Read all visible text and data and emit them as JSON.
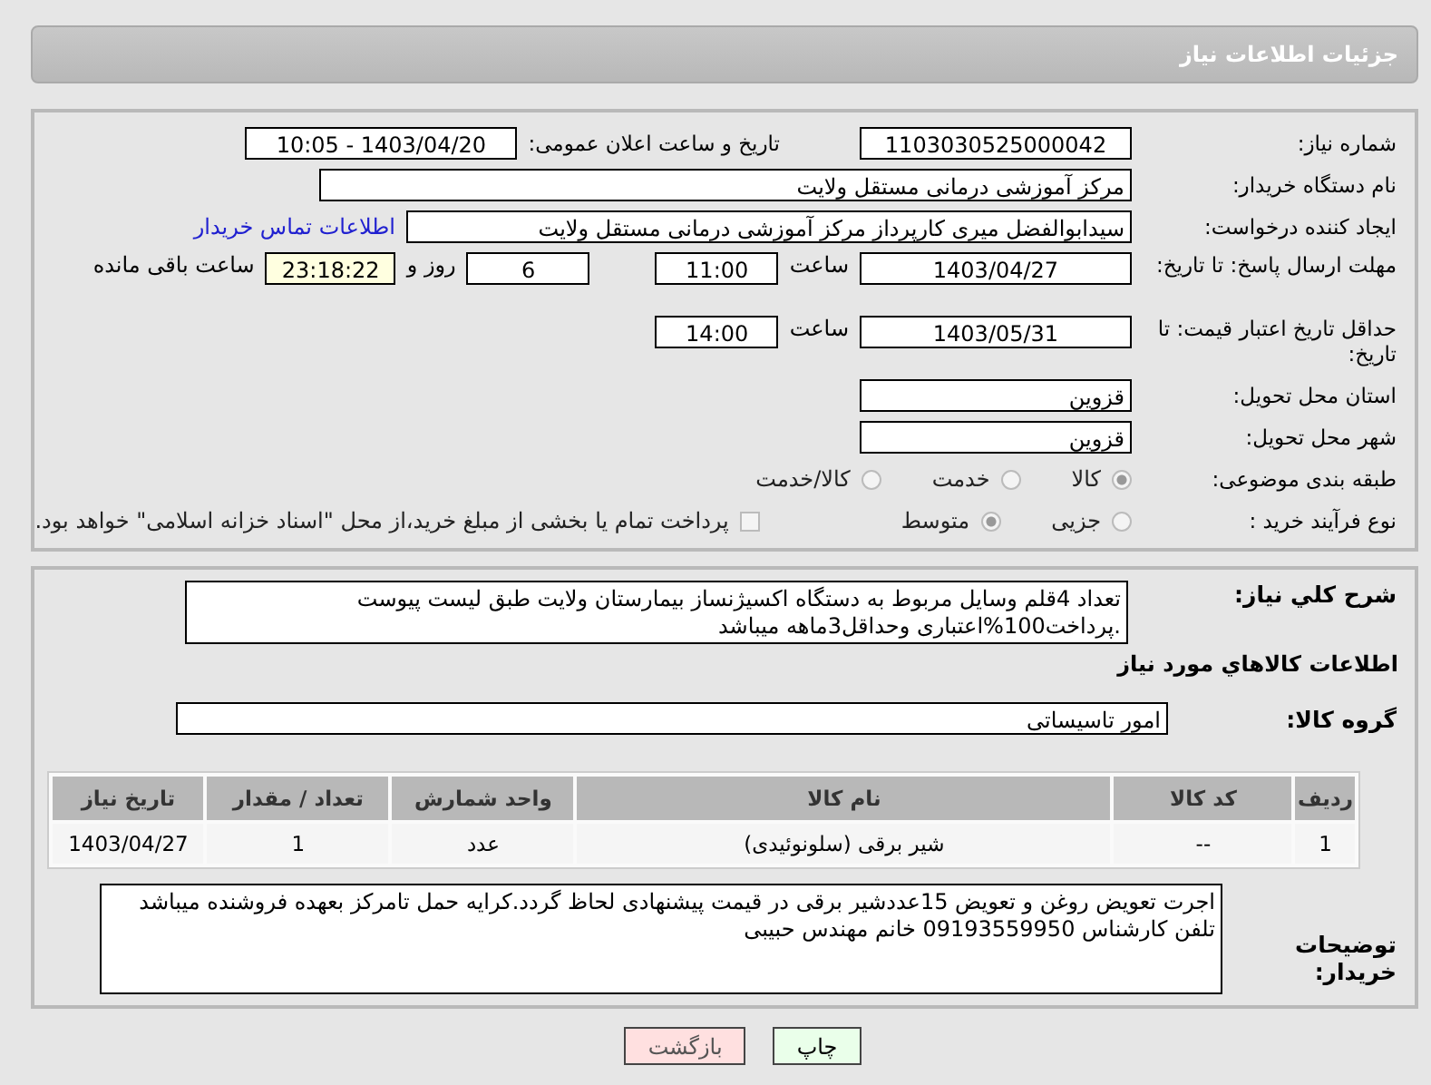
{
  "header": {
    "title": "جزئیات اطلاعات نیاز"
  },
  "need_number": {
    "label": "شماره نیاز:",
    "value": "1103030525000042"
  },
  "announce": {
    "label": "تاریخ و ساعت اعلان عمومی:",
    "value": "1403/04/20 - 10:05"
  },
  "buyer_org": {
    "label": "نام دستگاه خریدار:",
    "value": "مرکز آموزشی درمانی مستقل ولایت"
  },
  "requester": {
    "label": "ایجاد کننده درخواست:",
    "value": "سیدابوالفضل میری کارپرداز مرکز آموزشی درمانی مستقل ولایت",
    "link": "اطلاعات تماس خریدار"
  },
  "deadline": {
    "label": "مهلت ارسال پاسخ: تا تاریخ:",
    "date": "1403/04/27",
    "time_label": "ساعت",
    "time": "11:00",
    "days": "6",
    "days_label": "روز و",
    "remaining": "23:18:22",
    "remaining_label": "ساعت باقی مانده"
  },
  "validity": {
    "label": "حداقل تاریخ اعتبار قیمت: تا تاریخ:",
    "date": "1403/05/31",
    "time_label": "ساعت",
    "time": "14:00"
  },
  "province": {
    "label": "استان محل تحویل:",
    "value": "قزوین"
  },
  "city": {
    "label": "شهر محل تحویل:",
    "value": "قزوین"
  },
  "category": {
    "label": "طبقه بندی موضوعی:",
    "options": [
      {
        "label": "کالا",
        "selected": true
      },
      {
        "label": "خدمت",
        "selected": false
      },
      {
        "label": "کالا/خدمت",
        "selected": false
      }
    ]
  },
  "process": {
    "label": "نوع فرآیند خرید :",
    "options": [
      {
        "label": "جزیی",
        "selected": false
      },
      {
        "label": "متوسط",
        "selected": true
      }
    ],
    "payment": {
      "label": "پرداخت تمام یا بخشی از مبلغ خرید،از محل \"اسناد خزانه اسلامی\" خواهد بود.",
      "checked": false
    }
  },
  "description": {
    "label": "شرح کلي نیاز:",
    "value": "تعداد 4قلم وسایل مربوط به دستگاه اکسیژنساز بیمارستان ولایت طبق لیست پیوست .پرداخت100%اعتباری وحداقل3ماهه میباشد"
  },
  "goods_title": "اطلاعات کالاهاي مورد نیاز",
  "goods_group": {
    "label": "گروه کالا:",
    "value": "امور تاسیساتی"
  },
  "table": {
    "columns": [
      "ردیف",
      "کد کالا",
      "نام کالا",
      "واحد شمارش",
      "تعداد / مقدار",
      "تاریخ نیاز"
    ],
    "rows": [
      [
        "1",
        "--",
        "شیر برقی (سلونوئیدی)",
        "عدد",
        "1",
        "1403/04/27"
      ]
    ]
  },
  "buyer_notes": {
    "label": "توضیحات خریدار:",
    "value": "اجرت تعویض روغن و تعویض 15عددشیر برقی در قیمت پیشنهادی لحاظ گردد.کرایه حمل تامرکز بعهده فروشنده میباشد تلفن کارشناس 09193559950 خانم مهندس حبیبی"
  },
  "buttons": [
    {
      "label": "چاپ",
      "kind": "print"
    },
    {
      "label": "بازگشت",
      "kind": "back"
    }
  ]
}
